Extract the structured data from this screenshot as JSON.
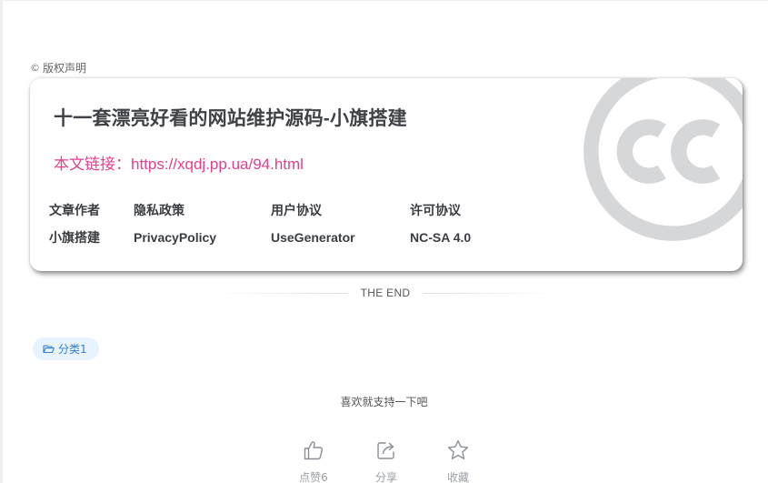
{
  "copyright": {
    "icon": "copyright-icon",
    "label": "版权声明"
  },
  "card": {
    "title": "十一套漂亮好看的网站维护源码-小旗搭建",
    "link_prefix": "本文链接：",
    "link_url": "https://xqdj.pp.ua/94.html",
    "watermark_icon": "creative-commons-icon",
    "info": [
      {
        "head": "文章作者",
        "value": "小旗搭建"
      },
      {
        "head": "隐私政策",
        "value": "PrivacyPolicy"
      },
      {
        "head": "用户协议",
        "value": "UseGenerator"
      },
      {
        "head": "许可协议",
        "value": "NC-SA 4.0"
      }
    ]
  },
  "the_end": "THE END",
  "category": {
    "icon": "folder-open-icon",
    "label": "分类1"
  },
  "support_text": "喜欢就支持一下吧",
  "actions": [
    {
      "icon": "thumbs-up-icon",
      "label": "点赞6"
    },
    {
      "icon": "share-icon",
      "label": "分享"
    },
    {
      "icon": "star-icon",
      "label": "收藏"
    }
  ],
  "colors": {
    "link": "#e2408e",
    "tag_bg": "#e9f3fe",
    "tag_text": "#2f7fd8",
    "title": "#3f4246",
    "watermark": "#d6d7d9"
  }
}
